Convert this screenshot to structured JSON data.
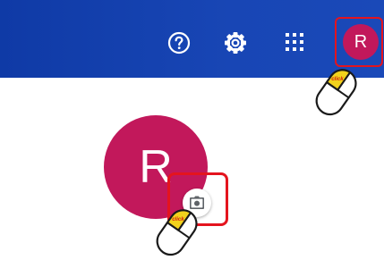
{
  "header": {
    "background_color": "#1846b5",
    "help_icon": "help-circle-icon",
    "settings_icon": "gear-icon",
    "apps_icon": "app-grid-icon",
    "account_initial": "R",
    "account_color": "#c2185b"
  },
  "profile": {
    "avatar_initial": "R",
    "avatar_color": "#c2185b",
    "change_photo_icon": "camera-icon"
  },
  "annotations": {
    "highlight_color": "#e4141e",
    "click_label": "click"
  }
}
